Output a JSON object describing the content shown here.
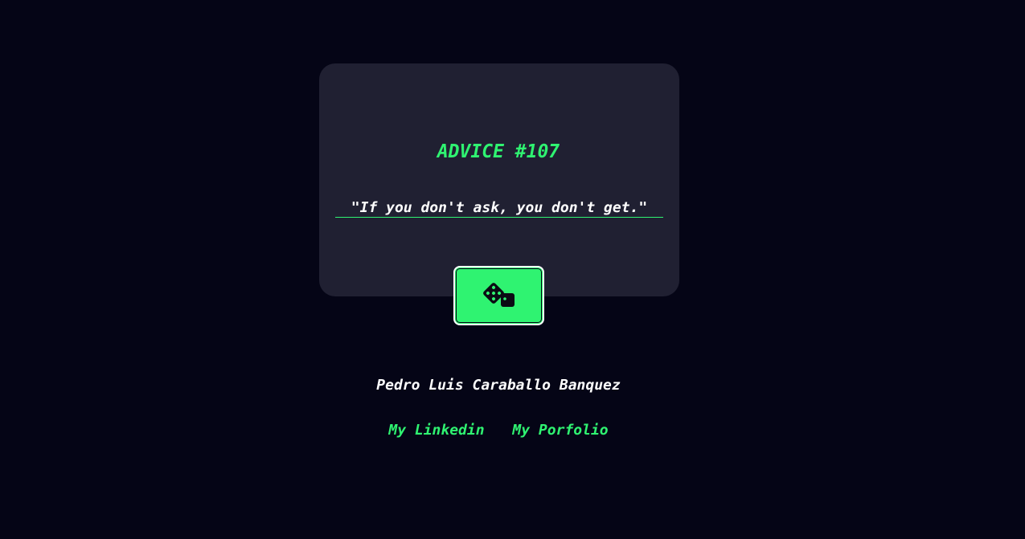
{
  "advice": {
    "title": "ADVICE #107",
    "quote": "\"If you don't ask, you don't get.\""
  },
  "button": {
    "icon": "dice-icon"
  },
  "footer": {
    "author": "Pedro Luis Caraballo Banquez",
    "links": [
      {
        "label": "My Linkedin"
      },
      {
        "label": "My Porfolio"
      }
    ]
  },
  "colors": {
    "background": "#050516",
    "card": "#202032",
    "accent": "#2ff371",
    "text": "#ffffff"
  }
}
